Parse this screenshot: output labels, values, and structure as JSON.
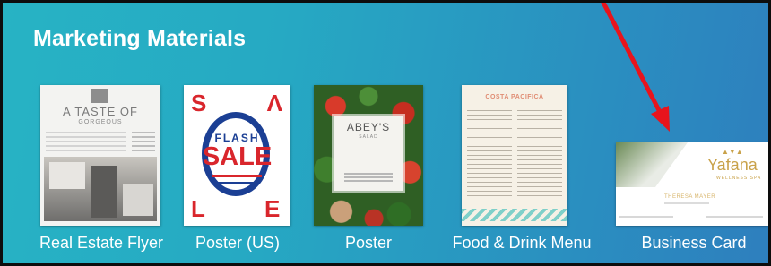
{
  "section": {
    "title": "Marketing Materials"
  },
  "items": [
    {
      "label": "Real Estate Flyer",
      "thumb": {
        "heading": "A TASTE OF",
        "subheading": "GORGEOUS"
      }
    },
    {
      "label": "Poster (US)",
      "thumb": {
        "line1": "FLASH",
        "line2": "SALE"
      }
    },
    {
      "label": "Poster",
      "thumb": {
        "name": "ABEY'S",
        "tag": "SALAD"
      }
    },
    {
      "label": "Food & Drink Menu",
      "thumb": {
        "brand": "COSTA PACIFICA"
      }
    },
    {
      "label": "Business Card",
      "thumb": {
        "brand": "Yafana",
        "sub": "WELLNESS SPA",
        "person": "THERESA MAYER"
      }
    }
  ],
  "colors": {
    "panel_gradient_start": "#27b3c4",
    "panel_gradient_end": "#2e7fbe",
    "annotation_arrow": "#e8141c",
    "sale_red": "#d9262c",
    "sale_blue": "#1b3f94"
  },
  "icons": [
    "red-annotation-arrow"
  ]
}
